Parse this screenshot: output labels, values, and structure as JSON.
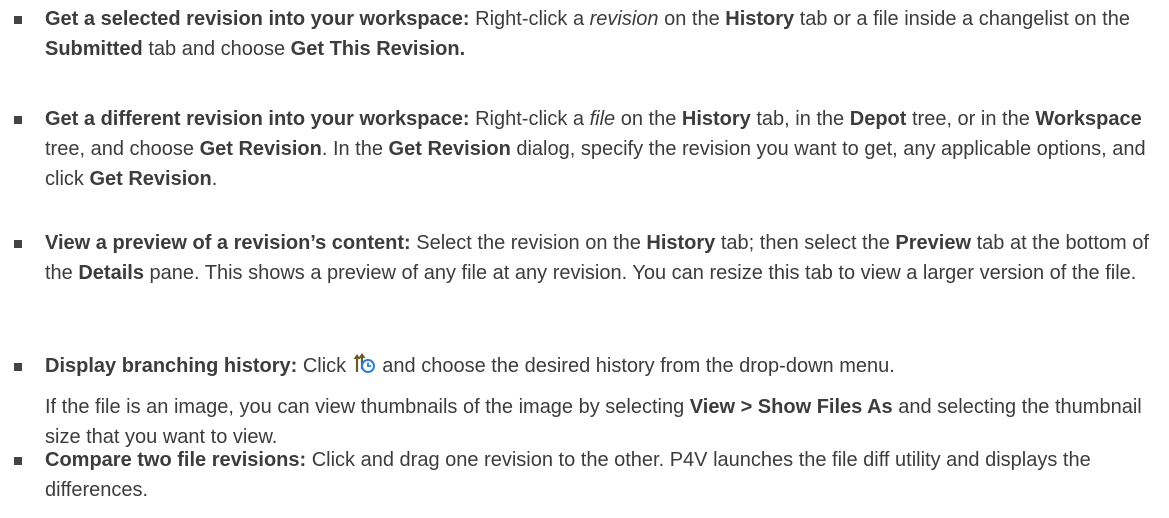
{
  "items": [
    {
      "term": "Get a selected revision into your workspace:",
      "t1": " Right-click a ",
      "i1": "revision",
      "t2": " on the ",
      "b1": "History",
      "t3": " tab or a file inside a changelist on the ",
      "b2": "Submitted",
      "t4": " tab and choose ",
      "b3": "Get This Revision."
    },
    {
      "term": "Get a different revision into your workspace:",
      "t1": " Right-click a ",
      "i1": "file",
      "t2": " on the ",
      "b1": "History",
      "t3": " tab, in the ",
      "b2": "Depot",
      "t4": " tree, or in the ",
      "b3": "Workspace",
      "t5": " tree, and choose ",
      "b4": "Get Revision",
      "t6": ". In the ",
      "b5": "Get Revision",
      "t7": " dialog, specify the revision you want to get, any applicable options, and click ",
      "b6": "Get Revision",
      "t8": "."
    },
    {
      "term": "View a preview of a revision’s content:",
      "t1": " Select the revision on the ",
      "b1": "History",
      "t2": " tab; then select the ",
      "b2": "Preview",
      "t3": " tab at the bottom of the ",
      "b3": "Details",
      "t4": " pane. This shows a preview of any file at any revision. You can resize this tab to view a larger version of the file."
    },
    {
      "term": "Display branching history:",
      "t1": " Click ",
      "icon": "branching-history-icon",
      "t2": " and choose the desired history from the drop-down menu.",
      "extra": {
        "t1": "If the file is an image, you can view thumbnails of the image by selecting ",
        "b1": "View > Show Files As",
        "t2": " and selecting the thumbnail size that you want to view."
      }
    },
    {
      "term": "Compare two file revisions:",
      "t1": " Click and drag one revision to the other. P4V launches the file diff utility and displays the differences."
    }
  ],
  "colors": {
    "text": "#3c3c3c",
    "bullet": "#444444",
    "icon_arrows": "#6b5a2a",
    "icon_clock": "#2a7fd4"
  }
}
